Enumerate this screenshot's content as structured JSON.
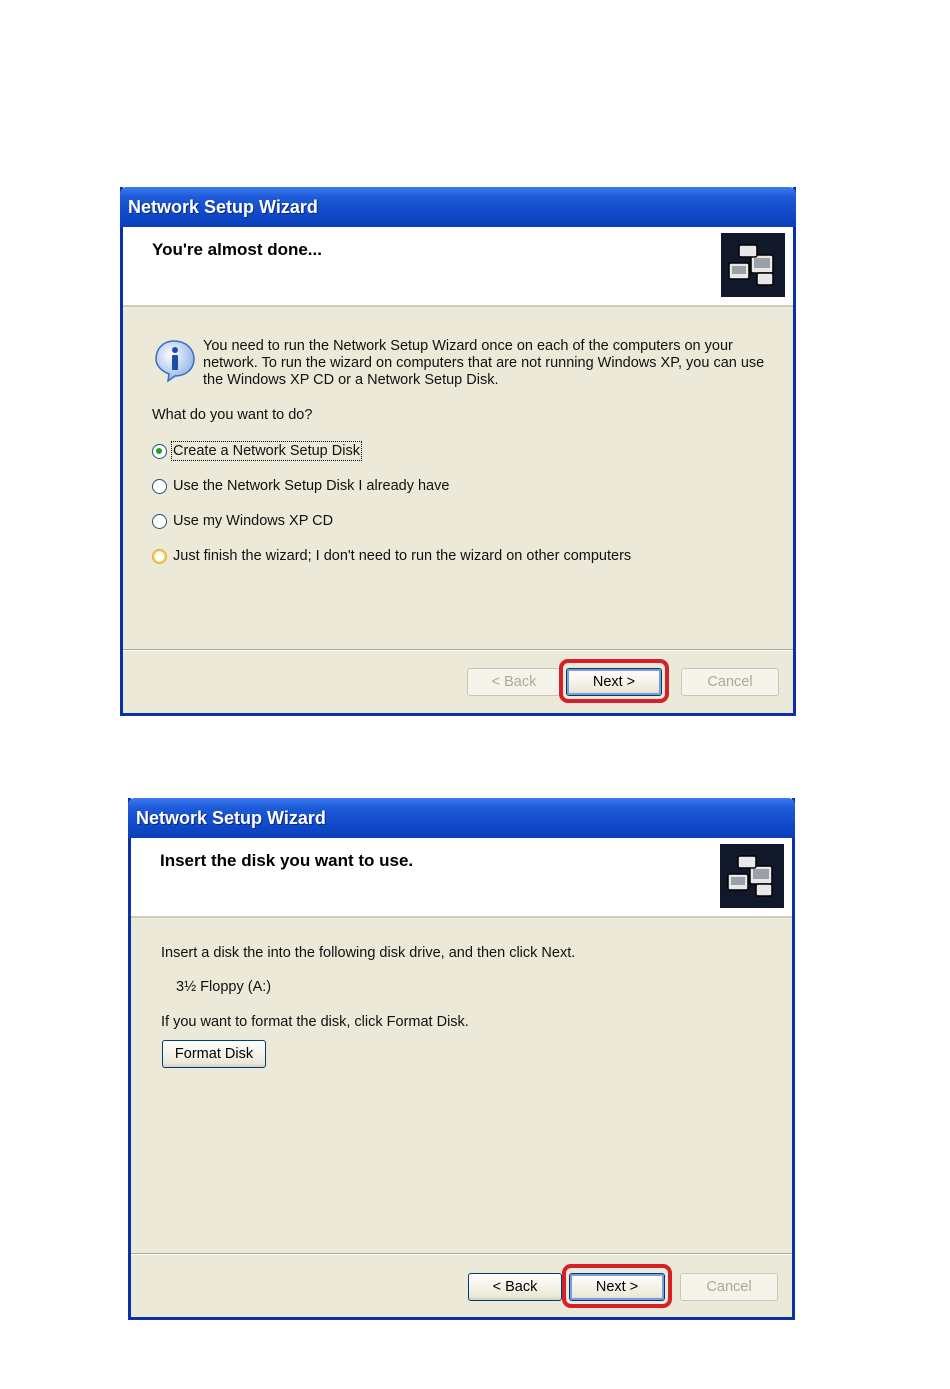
{
  "dialog1": {
    "title": "Network Setup Wizard",
    "heading": "You're almost done...",
    "info_line1": "You need to run the Network Setup Wizard once on each of the computers on your",
    "info_line2": "network. To run the wizard on computers that are not running Windows XP, you can use",
    "info_line3": "the Windows XP CD or a Network Setup Disk.",
    "question": "What do you want to do?",
    "options": [
      {
        "label": "Create a Network Setup Disk",
        "selected": true
      },
      {
        "label": "Use the Network Setup Disk I already have",
        "selected": false
      },
      {
        "label": "Use my Windows XP CD",
        "selected": false
      },
      {
        "label": "Just finish the wizard; I don't need to run the wizard on other computers",
        "selected": false
      }
    ],
    "back_label": "< Back",
    "next_label": "Next >",
    "cancel_label": "Cancel"
  },
  "dialog2": {
    "title": "Network Setup Wizard",
    "heading": "Insert the disk you want to use.",
    "instruction": "Insert a disk the into the following disk drive, and then click Next.",
    "drive": "3½ Floppy (A:)",
    "format_hint": "If you want to format the disk, click Format Disk.",
    "format_label": "Format Disk",
    "back_label": "< Back",
    "next_label": "Next >",
    "cancel_label": "Cancel"
  },
  "colors": {
    "title_bar": "#0f48c8",
    "dialog_bg": "#ece9d8",
    "highlight": "#d62028",
    "selected_radio": "#21a121"
  },
  "icons": [
    "network-wizard-icon",
    "info-icon"
  ]
}
